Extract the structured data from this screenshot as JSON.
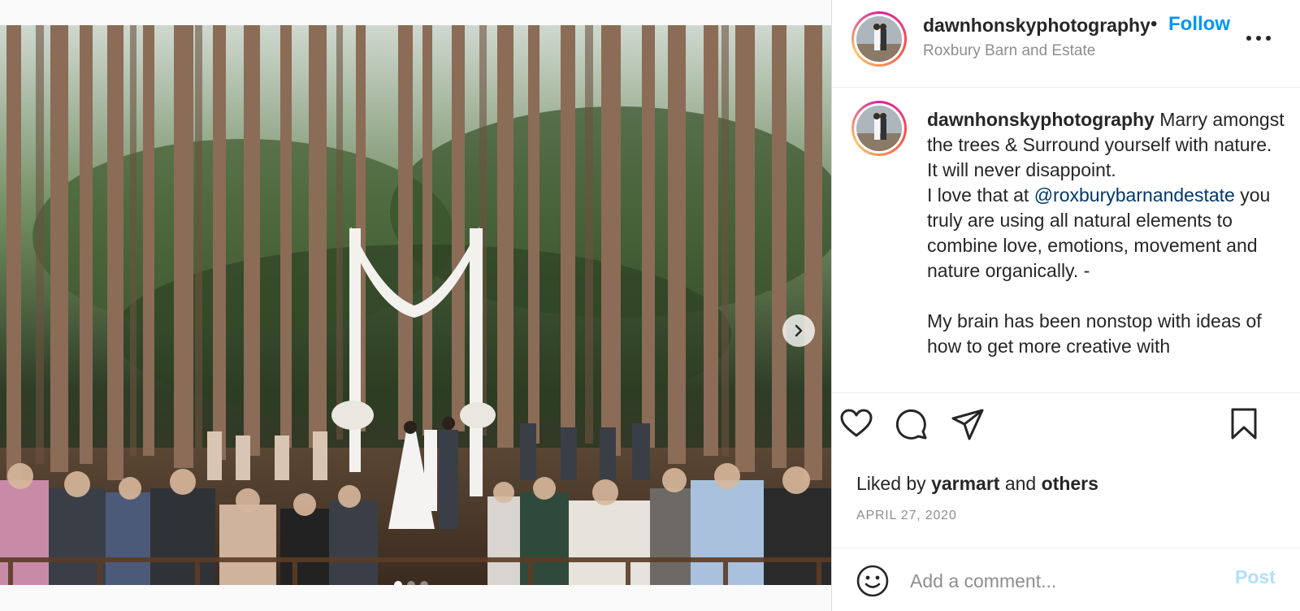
{
  "post": {
    "image_alt": "Wedding ceremony in a pine forest",
    "slide_count": 3,
    "active_slide": 1
  },
  "header": {
    "username": "dawnhonskyphotography",
    "separator": "•",
    "follow_label": "Follow",
    "location": "Roxbury Barn and Estate"
  },
  "caption": {
    "username": "dawnhonskyphotography",
    "line1": " Marry amongst the trees & Surround yourself with nature.",
    "line2": "It will never disappoint.",
    "line3_prefix": "I love that at ",
    "mention": "@roxburybarnandestate",
    "line3_suffix": " you truly are using all natural elements to combine love, emotions, movement and nature organically. -",
    "line4": "My brain has been nonstop with ideas of how to get more creative with"
  },
  "engagement": {
    "liked_by_prefix": "Liked by ",
    "liked_by_user": "yarmart",
    "liked_by_mid": " and ",
    "liked_by_others": "others",
    "date": "APRIL 27, 2020"
  },
  "comment": {
    "placeholder": "Add a comment...",
    "post_label": "Post"
  },
  "icons": {
    "like": "heart-icon",
    "comment": "comment-bubble-icon",
    "share": "paper-plane-icon",
    "save": "bookmark-icon",
    "more": "more-horizontal-icon",
    "emoji": "emoji-smile-icon",
    "next": "chevron-right-icon"
  },
  "colors": {
    "link_blue": "#0095f6",
    "mention_blue": "#00376b",
    "muted_gray": "#8e8e8e",
    "post_disabled": "#b2dffc"
  }
}
